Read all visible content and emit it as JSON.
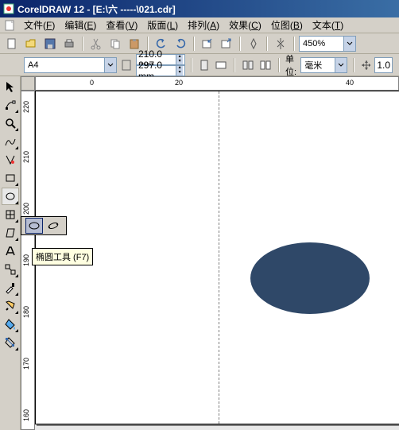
{
  "title": "CorelDRAW 12 - [E:\\六  -----\\021.cdr]",
  "menu": {
    "items": [
      {
        "label": "文件",
        "key": "F"
      },
      {
        "label": "编辑",
        "key": "E"
      },
      {
        "label": "查看",
        "key": "V"
      },
      {
        "label": "版面",
        "key": "L"
      },
      {
        "label": "排列",
        "key": "A"
      },
      {
        "label": "效果",
        "key": "C"
      },
      {
        "label": "位图",
        "key": "B"
      },
      {
        "label": "文本",
        "key": "T"
      }
    ]
  },
  "toolbar_main": {
    "zoom": "450%"
  },
  "propbar": {
    "paper": "A4",
    "width": "210.0 mm",
    "height": "297.0 mm",
    "unit_label": "单位:",
    "unit_value": "毫米",
    "nudge": "1.0"
  },
  "ruler": {
    "h_ticks": [
      "0",
      "20",
      "40"
    ],
    "v_ticks": [
      "220",
      "210",
      "200",
      "190",
      "180",
      "170",
      "160"
    ]
  },
  "tooltip": {
    "text": "椭圆工具  (F7)"
  },
  "canvas": {
    "ellipse_color": "#2f4868"
  }
}
